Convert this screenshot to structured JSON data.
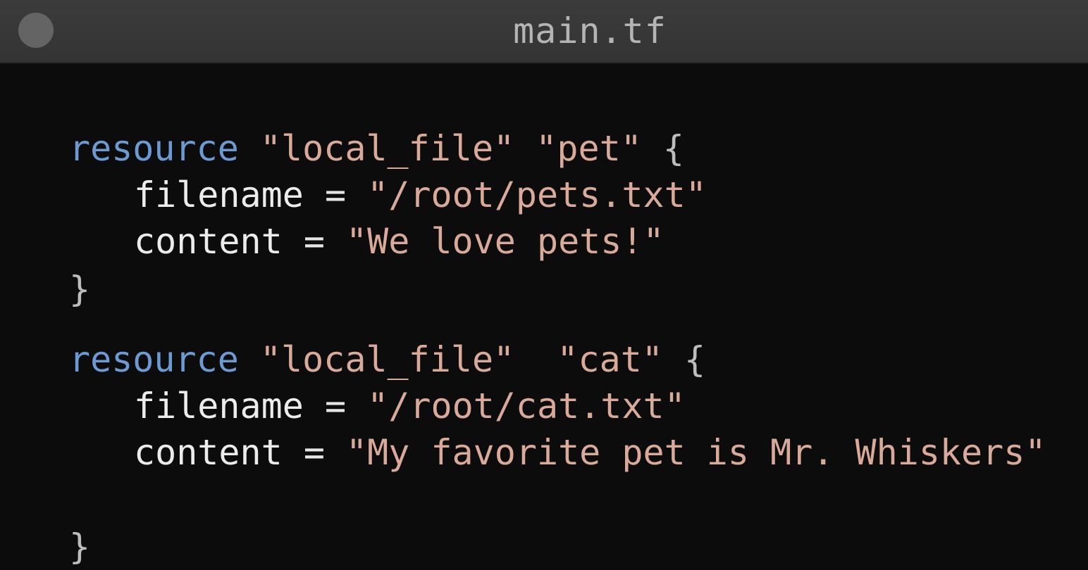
{
  "window": {
    "title": "main.tf"
  },
  "code": {
    "block1": {
      "keyword": "resource",
      "type": "\"local_file\"",
      "name": "\"pet\"",
      "open_brace": "{",
      "attr1_key": "filename",
      "attr1_eq": "=",
      "attr1_value": "\"/root/pets.txt\"",
      "attr2_key": "content",
      "attr2_eq": "=",
      "attr2_value": "\"We love pets!\"",
      "close_brace": "}"
    },
    "block2": {
      "keyword": "resource",
      "type": "\"local_file\"",
      "name": "\"cat\"",
      "open_brace": "{",
      "attr1_key": "filename",
      "attr1_eq": "=",
      "attr1_value": "\"/root/cat.txt\"",
      "attr2_key": "content",
      "attr2_eq": "=",
      "attr2_value": "\"My favorite pet is Mr. Whiskers\"",
      "close_brace": "}"
    }
  },
  "colors": {
    "keyword": "#6c9bd4",
    "string": "#d9a99a",
    "identifier": "#ececec",
    "background": "#0c0c0c",
    "titlebar": "#383838"
  }
}
